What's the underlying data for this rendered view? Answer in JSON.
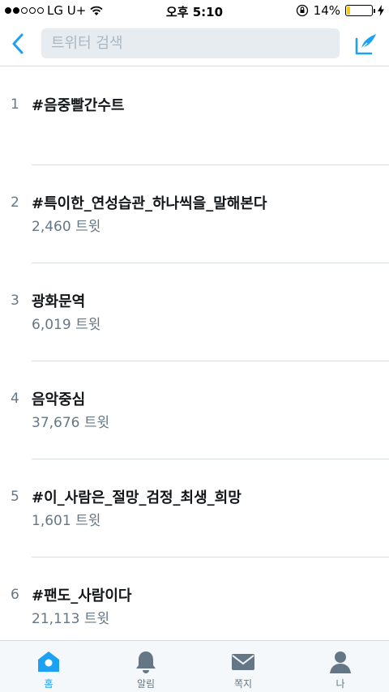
{
  "status_bar": {
    "carrier": "LG U+",
    "time": "오후 5:10",
    "battery": "14%",
    "battery_level": 0.14
  },
  "header": {
    "search_placeholder": "트위터 검색",
    "back_icon": "chevron-left-icon",
    "compose_icon": "compose-icon"
  },
  "trends": [
    {
      "rank": "1",
      "name": "#음중빨간수트",
      "count": ""
    },
    {
      "rank": "2",
      "name": "#특이한_연성습관_하나씩을_말해본다",
      "count": "2,460 트윗"
    },
    {
      "rank": "3",
      "name": "광화문역",
      "count": "6,019 트윗"
    },
    {
      "rank": "4",
      "name": "음악중심",
      "count": "37,676 트윗"
    },
    {
      "rank": "5",
      "name": "#이_사람은_절망_검정_최생_희망",
      "count": "1,601 트윗"
    },
    {
      "rank": "6",
      "name": "#팬도_사람이다",
      "count": "21,113 트윗"
    }
  ],
  "tabs": [
    {
      "label": "홈",
      "icon": "home-icon",
      "active": true
    },
    {
      "label": "알림",
      "icon": "bell-icon",
      "active": false
    },
    {
      "label": "쪽지",
      "icon": "envelope-icon",
      "active": false
    },
    {
      "label": "나",
      "icon": "person-icon",
      "active": false
    }
  ],
  "colors": {
    "accent": "#1da1f2",
    "muted": "#657786",
    "divider": "#d8dde1",
    "search_bg": "#e6ecf0",
    "battery_fill": "#f5c518"
  }
}
